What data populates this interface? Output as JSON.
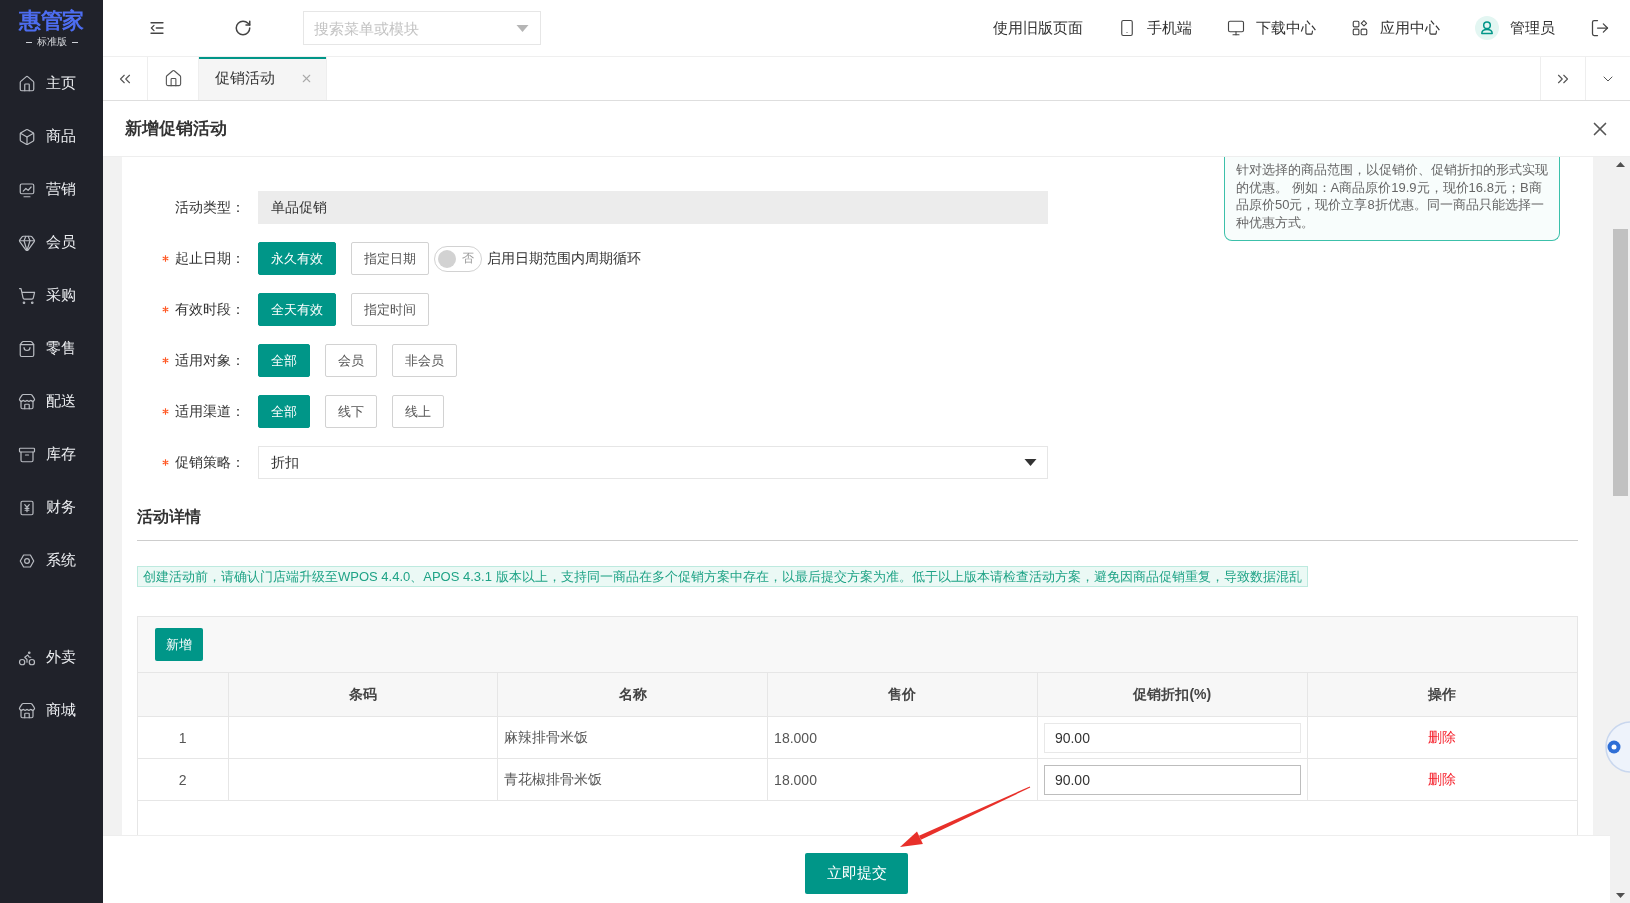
{
  "sidebar": {
    "logo": {
      "title": "惠管家",
      "edition": "标准版"
    },
    "items": [
      {
        "label": "主页",
        "selected": false
      },
      {
        "label": "商品",
        "selected": false
      },
      {
        "label": "营销",
        "selected": false
      },
      {
        "label": "会员",
        "selected": false
      },
      {
        "label": "采购",
        "selected": false
      },
      {
        "label": "零售",
        "selected": false
      },
      {
        "label": "配送",
        "selected": false
      },
      {
        "label": "库存",
        "selected": false
      },
      {
        "label": "财务",
        "selected": false
      },
      {
        "label": "系统",
        "selected": false
      }
    ],
    "extra_items": [
      {
        "label": "外卖",
        "selected": false
      },
      {
        "label": "商城",
        "selected": false
      }
    ]
  },
  "header": {
    "search": {
      "placeholder": "搜索菜单或模块"
    },
    "links": [
      {
        "kind": "plain",
        "label": "使用旧版页面"
      },
      {
        "kind": "mobile",
        "label": "手机端"
      },
      {
        "kind": "download",
        "label": "下载中心"
      },
      {
        "kind": "apps",
        "label": "应用中心"
      },
      {
        "kind": "user",
        "label": "管理员"
      }
    ]
  },
  "tabs": [
    {
      "kind": "home",
      "selected": false
    },
    {
      "kind": "page",
      "label": "促销活动",
      "selected": true
    }
  ],
  "modal": {
    "title": "新增促销活动",
    "form": [
      {
        "kind": "readonly",
        "label": "活动类型：",
        "required": false,
        "value": "单品促销"
      },
      {
        "kind": "options",
        "label": "起止日期：",
        "required": true,
        "options": [
          {
            "label": "永久有效",
            "selected": true
          },
          {
            "label": "指定日期",
            "selected": false
          }
        ],
        "switch": {
          "on": false,
          "text": "否",
          "caption": "启用日期范围内周期循环"
        }
      },
      {
        "kind": "options",
        "label": "有效时段：",
        "required": true,
        "options": [
          {
            "label": "全天有效",
            "selected": true
          },
          {
            "label": "指定时间",
            "selected": false
          }
        ]
      },
      {
        "kind": "options",
        "label": "适用对象：",
        "required": true,
        "options": [
          {
            "label": "全部",
            "selected": true
          },
          {
            "label": "会员",
            "selected": false
          },
          {
            "label": "非会员",
            "selected": false
          }
        ]
      },
      {
        "kind": "options",
        "label": "适用渠道：",
        "required": true,
        "options": [
          {
            "label": "全部",
            "selected": true
          },
          {
            "label": "线下",
            "selected": false
          },
          {
            "label": "线上",
            "selected": false
          }
        ]
      },
      {
        "kind": "select",
        "label": "促销策略：",
        "required": true,
        "value": "折扣"
      }
    ],
    "tip": "针对选择的商品范围，以促销价、促销折扣的形式实现的优惠。 例如：A商品原价19.9元，现价16.8元；B商品原价50元，现价立享8折优惠。同一商品只能选择一种优惠方式。",
    "section_title": "活动详情",
    "notice": "创建活动前，请确认门店端升级至WPOS 4.4.0、APOS 4.3.1 版本以上，支持同一商品在多个促销方案中存在，以最后提交方案为准。低于以上版本请检查活动方案，避免因商品促销重复，导致数据混乱",
    "table": {
      "add_button": "新增",
      "columns": [
        {
          "kind": "index"
        },
        {
          "kind": "heading",
          "label": "条码"
        },
        {
          "kind": "heading",
          "label": "名称"
        },
        {
          "kind": "heading",
          "label": "售价"
        },
        {
          "kind": "heading",
          "label": "促销折扣(%)"
        },
        {
          "kind": "heading",
          "label": "操作"
        }
      ],
      "rows": [
        {
          "cells": [
            {
              "kind": "index",
              "text": "1"
            },
            {
              "kind": "empty"
            },
            {
              "kind": "text",
              "text": "麻辣排骨米饭"
            },
            {
              "kind": "text",
              "text": "18.000"
            },
            {
              "kind": "input",
              "value": "90.00",
              "focused": false
            },
            {
              "kind": "link",
              "text": "删除"
            }
          ]
        },
        {
          "cells": [
            {
              "kind": "index",
              "text": "2"
            },
            {
              "kind": "empty"
            },
            {
              "kind": "text",
              "text": "青花椒排骨米饭"
            },
            {
              "kind": "text",
              "text": "18.000"
            },
            {
              "kind": "input",
              "value": "90.00",
              "focused": true
            },
            {
              "kind": "link",
              "text": "删除"
            }
          ]
        }
      ]
    },
    "submit_button": "立即提交"
  }
}
